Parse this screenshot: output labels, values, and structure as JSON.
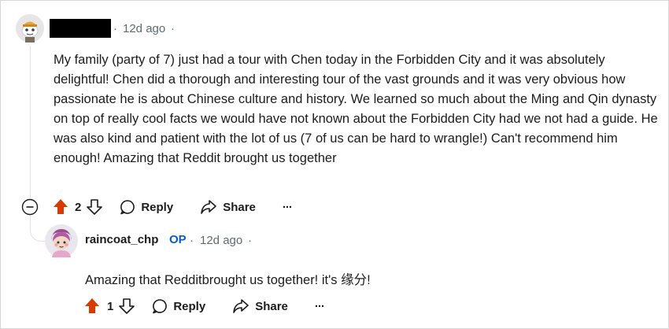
{
  "comment": {
    "time_ago": "12d ago",
    "body": "My family (party of 7) just had a tour with Chen today in the Forbidden City and it was absolutely delightful! Chen did a thorough and interesting tour of the vast grounds and it was very obvious how passionate he is about Chinese culture and history. We learned so much about the Ming and Qin dynasty on top of really cool facts we would have not known about the Forbidden City had we not had a guide. He was also kind and patient with the lot of us (7 of us can be hard to wrangle!) Can't recommend him enough! Amazing that Reddit brought us together",
    "score": "2",
    "reply_label": "Reply",
    "share_label": "Share",
    "more_label": "···",
    "collapse_symbol": "⊖",
    "separator_dot": "·"
  },
  "reply": {
    "author": "raincoat_chp",
    "badge": "OP",
    "time_ago": "12d ago",
    "body": "Amazing that Redditbrought us together! it's 缘分!",
    "score": "1",
    "reply_label": "Reply",
    "share_label": "Share",
    "more_label": "···"
  },
  "colors": {
    "upvote_active": "#d93a00",
    "op_badge": "#0a5cc4",
    "meta": "#5c6a73"
  },
  "icons": [
    "snoo-avatar-icon",
    "cartoon-avatar-icon",
    "collapse-icon",
    "upvote-icon",
    "downvote-icon",
    "reply-bubble-icon",
    "share-arrow-icon",
    "more-options-icon"
  ]
}
